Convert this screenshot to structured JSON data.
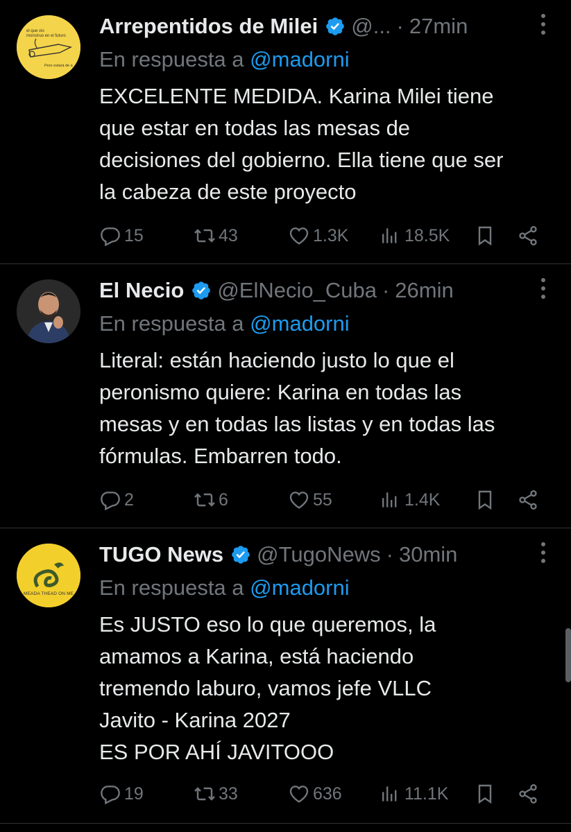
{
  "tweets": [
    {
      "name": "Arrepentidos de Milei",
      "handle": "@...",
      "time": "27min",
      "reply_prefix": "En respuesta a",
      "reply_to": "@madorni",
      "text": "EXCELENTE MEDIDA. Karina Milei tiene\nque estar en todas las mesas de\ndecisiones del gobierno. Ella tiene que ser\nla cabeza de este proyecto",
      "replies": "15",
      "retweets": "43",
      "likes": "1.3K",
      "views": "18.5K",
      "avatar_text_top": "el que vio\nmonstruo en\nel futuro",
      "avatar_text_bottom": "Pero estará de a"
    },
    {
      "name": "El Necio",
      "handle": "@ElNecio_Cuba",
      "time": "26min",
      "reply_prefix": "En respuesta a",
      "reply_to": "@madorni",
      "text": "Literal: están haciendo justo lo que el\nperonismo quiere: Karina en todas las\nmesas y en todas las listas y en todas las\nfórmulas. Embarren todo.",
      "replies": "2",
      "retweets": "6",
      "likes": "55",
      "views": "1.4K"
    },
    {
      "name": "TUGO News",
      "handle": "@TugoNews",
      "time": "30min",
      "reply_prefix": "En respuesta a",
      "reply_to": "@madorni",
      "text": "Es JUSTO eso lo que queremos, la\namamos a Karina, está haciendo\ntremendo laburo, vamos jefe VLLC\nJavito - Karina 2027\nES POR AHÍ JAVITOOO",
      "replies": "19",
      "retweets": "33",
      "likes": "636",
      "views": "11.1K",
      "avatar_text": "MEADA THEAD ON ME"
    }
  ],
  "colors": {
    "background": "#000000",
    "text": "#e7e9ea",
    "muted": "#71767b",
    "link": "#1d9bf0",
    "verified": "#1d9bf0",
    "divider": "#2f3336"
  },
  "icons": [
    "verified-badge-icon",
    "more-icon",
    "reply-icon",
    "retweet-icon",
    "like-icon",
    "views-icon",
    "bookmark-icon",
    "share-icon"
  ]
}
